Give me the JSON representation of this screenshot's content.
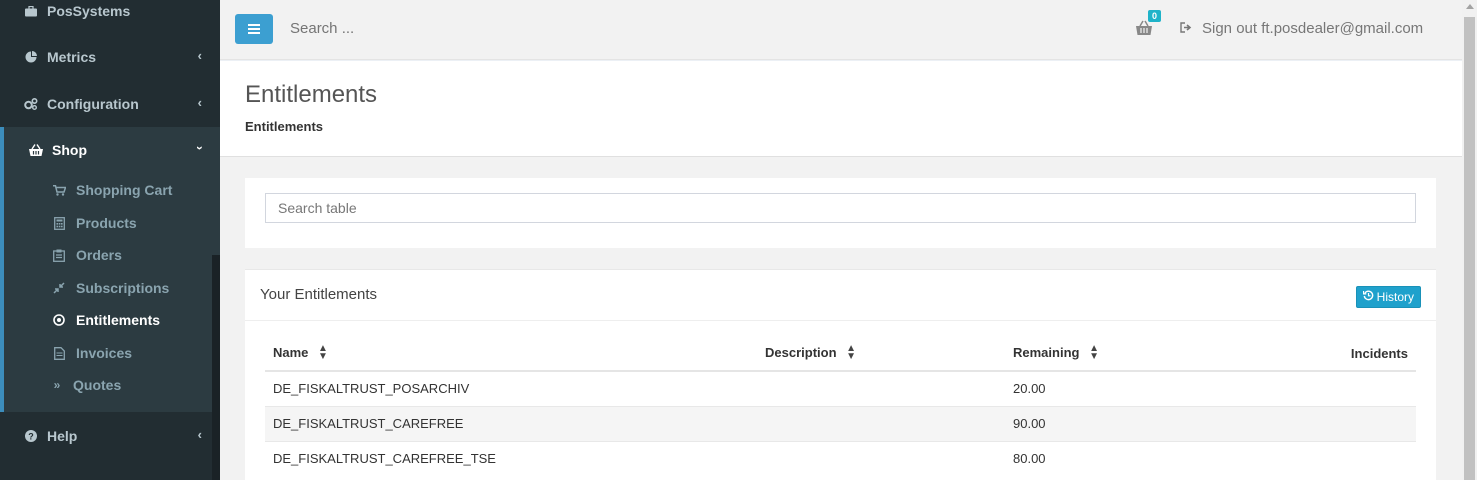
{
  "sidebar": {
    "items": [
      {
        "label": "PosSystems",
        "icon": "briefcase-icon"
      },
      {
        "label": "Metrics",
        "icon": "pie-chart-icon"
      },
      {
        "label": "Configuration",
        "icon": "cogs-icon"
      },
      {
        "label": "Shop",
        "icon": "basket-icon"
      },
      {
        "label": "Help",
        "icon": "question-circle-icon"
      }
    ],
    "shop_submenu": [
      {
        "label": "Shopping Cart",
        "icon": "cart-icon"
      },
      {
        "label": "Products",
        "icon": "calculator-icon"
      },
      {
        "label": "Orders",
        "icon": "clipboard-icon"
      },
      {
        "label": "Subscriptions",
        "icon": "compress-icon"
      },
      {
        "label": "Entitlements",
        "icon": "dot-circle-icon"
      },
      {
        "label": "Invoices",
        "icon": "file-icon"
      },
      {
        "label": "Quotes",
        "icon": "double-chevron-icon"
      }
    ]
  },
  "header": {
    "search_placeholder": "Search ...",
    "cart_count": "0",
    "signout_label": "Sign out ft.posdealer@gmail.com"
  },
  "page": {
    "title": "Entitlements",
    "breadcrumb": "Entitlements"
  },
  "search_table": {
    "placeholder": "Search table"
  },
  "entitlements_box": {
    "title": "Your Entitlements",
    "history_label": "History",
    "columns": [
      "Name",
      "Description",
      "Remaining",
      "Incidents"
    ],
    "rows": [
      {
        "name": "DE_FISKALTRUST_POSARCHIV",
        "description": "",
        "remaining": "20.00",
        "incidents": ""
      },
      {
        "name": "DE_FISKALTRUST_CAREFREE",
        "description": "",
        "remaining": "90.00",
        "incidents": ""
      },
      {
        "name": "DE_FISKALTRUST_CAREFREE_TSE",
        "description": "",
        "remaining": "80.00",
        "incidents": ""
      }
    ]
  },
  "colors": {
    "sidebar_bg": "#222d32",
    "accent": "#3c8dbc",
    "badge": "#1fb3c9",
    "history_btn": "#1fa1cc"
  }
}
